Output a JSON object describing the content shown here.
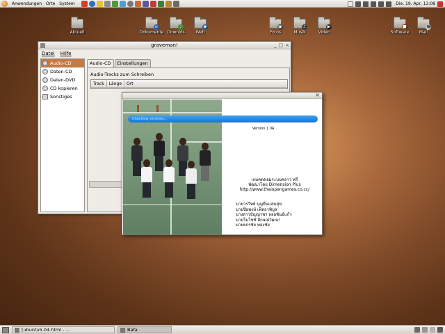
{
  "top_panel": {
    "menus": [
      "Anwendungen",
      "Orte",
      "System"
    ],
    "clock": "Die. 19. Apr, 13:08"
  },
  "desktop_icons": [
    {
      "label": "Aktuell"
    },
    {
      "label": "Dokumente"
    },
    {
      "label": "Downlds"
    },
    {
      "label": "Web"
    },
    {
      "label": "Fotos"
    },
    {
      "label": "Musik"
    },
    {
      "label": "Video"
    },
    {
      "label": "Software"
    },
    {
      "label": "Mail"
    }
  ],
  "window": {
    "title": "graveman!",
    "menu": [
      "Datei",
      "Hilfe"
    ],
    "sidebar": [
      "Audio-CD",
      "Daten-CD",
      "Daten-DVD",
      "CD kopieren",
      "Sonstiges"
    ],
    "selected_sidebar": "Audio-CD",
    "tabs": [
      "Audio-CD",
      "Einstellungen"
    ],
    "active_tab": "Audio-CD",
    "tab_label": "Audio-Tracks zum Schreiben",
    "columns": [
      "Track",
      "Länge",
      "Ort"
    ]
  },
  "splash": {
    "banner_text": "Checking versions...",
    "version": "Version 1.0A",
    "credit_lines": [
      "เกมคดคอมระบบคลาว ฟรี",
      "พัฒนาโดย Dimension Plus",
      "http://www.thaiopengames.co.cc/"
    ],
    "names": [
      "นายวรวิทย์ บุญยืนแสนสุข",
      "นายปิยพงษ์ เพ็ทธาพิบูล",
      "นางสาวปัญญาพร ลอยพันธ์แก้ว",
      "นายโมโชซ์ อึกษณ์วัฒนา",
      "นายยกรชัย ทองชัย"
    ]
  },
  "taskbar": {
    "tasks": [
      "[ubuntu5.04.html - ...",
      "Bafa"
    ]
  }
}
